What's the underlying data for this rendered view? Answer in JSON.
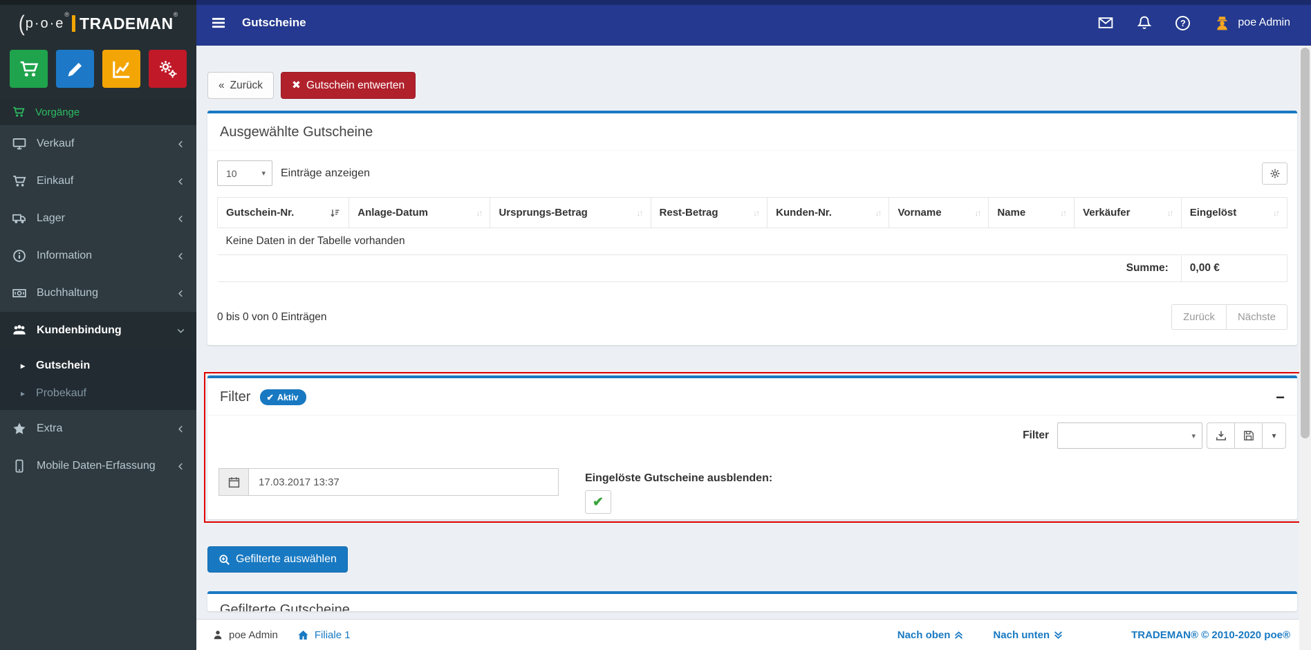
{
  "topbar": {
    "title": "Gutscheine",
    "user": "poe Admin",
    "icons": {
      "mail": "envelope-icon",
      "notifications": "bell-icon",
      "help": "question-circle-icon",
      "avatar": "user-avatar-icon"
    }
  },
  "sidebar": {
    "logo": {
      "paren": "(",
      "poe": "p·o·e",
      "reg": "®",
      "name": "TRADEMAN"
    },
    "quick_buttons": [
      {
        "name": "cart-icon",
        "color": "#1fa34c"
      },
      {
        "name": "pencil-icon",
        "color": "#1d79c7"
      },
      {
        "name": "chart-line-icon",
        "color": "#f3a505"
      },
      {
        "name": "gears-icon",
        "color": "#c11928"
      }
    ],
    "menu": [
      {
        "label": "Vorgänge",
        "icon": "cart-icon"
      },
      {
        "label": "Verkauf",
        "icon": "desktop-icon"
      },
      {
        "label": "Einkauf",
        "icon": "cart-icon"
      },
      {
        "label": "Lager",
        "icon": "truck-icon"
      },
      {
        "label": "Information",
        "icon": "info-circle-icon"
      },
      {
        "label": "Buchhaltung",
        "icon": "money-bill-icon"
      },
      {
        "label": "Kundenbindung",
        "icon": "users-icon"
      },
      {
        "label": "Extra",
        "icon": "star-icon"
      },
      {
        "label": "Mobile Daten-Erfassung",
        "icon": "mobile-icon"
      }
    ],
    "submenu": [
      {
        "label": "Gutschein"
      },
      {
        "label": "Probekauf"
      }
    ]
  },
  "toolbar": {
    "back_label": "Zurück",
    "devalue_label": "Gutschein entwerten"
  },
  "selected_panel": {
    "title": "Ausgewählte Gutscheine",
    "page_length": "10",
    "entries_label": "Einträge anzeigen",
    "columns": [
      "Gutschein-Nr.",
      "Anlage-Datum",
      "Ursprungs-Betrag",
      "Rest-Betrag",
      "Kunden-Nr.",
      "Vorname",
      "Name",
      "Verkäufer",
      "Eingelöst"
    ],
    "empty_text": "Keine Daten in der Tabelle vorhanden",
    "sum_label": "Summe:",
    "sum_value": "0,00 €",
    "info": "0 bis 0 von 0 Einträgen",
    "prev_label": "Zurück",
    "next_label": "Nächste"
  },
  "filter_panel": {
    "title": "Filter",
    "badge_label": "Aktiv",
    "filter_label": "Filter",
    "filter_select_value": "",
    "date_value": "17.03.2017 13:37",
    "hide_redeemed_label": "Eingelöste Gutscheine ausblenden:",
    "hide_redeemed_checked": true
  },
  "actions": {
    "select_filtered_label": "Gefilterte auswählen"
  },
  "partial_panel": {
    "title": "Gefilterte Gutscheine"
  },
  "footer": {
    "user": "poe Admin",
    "branch": "Filiale 1",
    "to_top": "Nach oben",
    "to_bottom": "Nach unten",
    "copyright": "TRADEMAN® © 2010-2020 poe®"
  },
  "icons": {
    "back": "«",
    "close": "✖",
    "check": "✔",
    "minus": "−",
    "caret_down": "▾",
    "caret_right": "▸",
    "sort_down": "↓",
    "sort_up": "↑",
    "question": "?"
  },
  "colors": {
    "topbar_blue": "#24398f",
    "primary_blue": "#1879c2",
    "danger_red": "#b0212c",
    "highlight_red": "#e00000",
    "sidebar_dark": "#2e3a40",
    "active_green": "#2dbd62"
  }
}
